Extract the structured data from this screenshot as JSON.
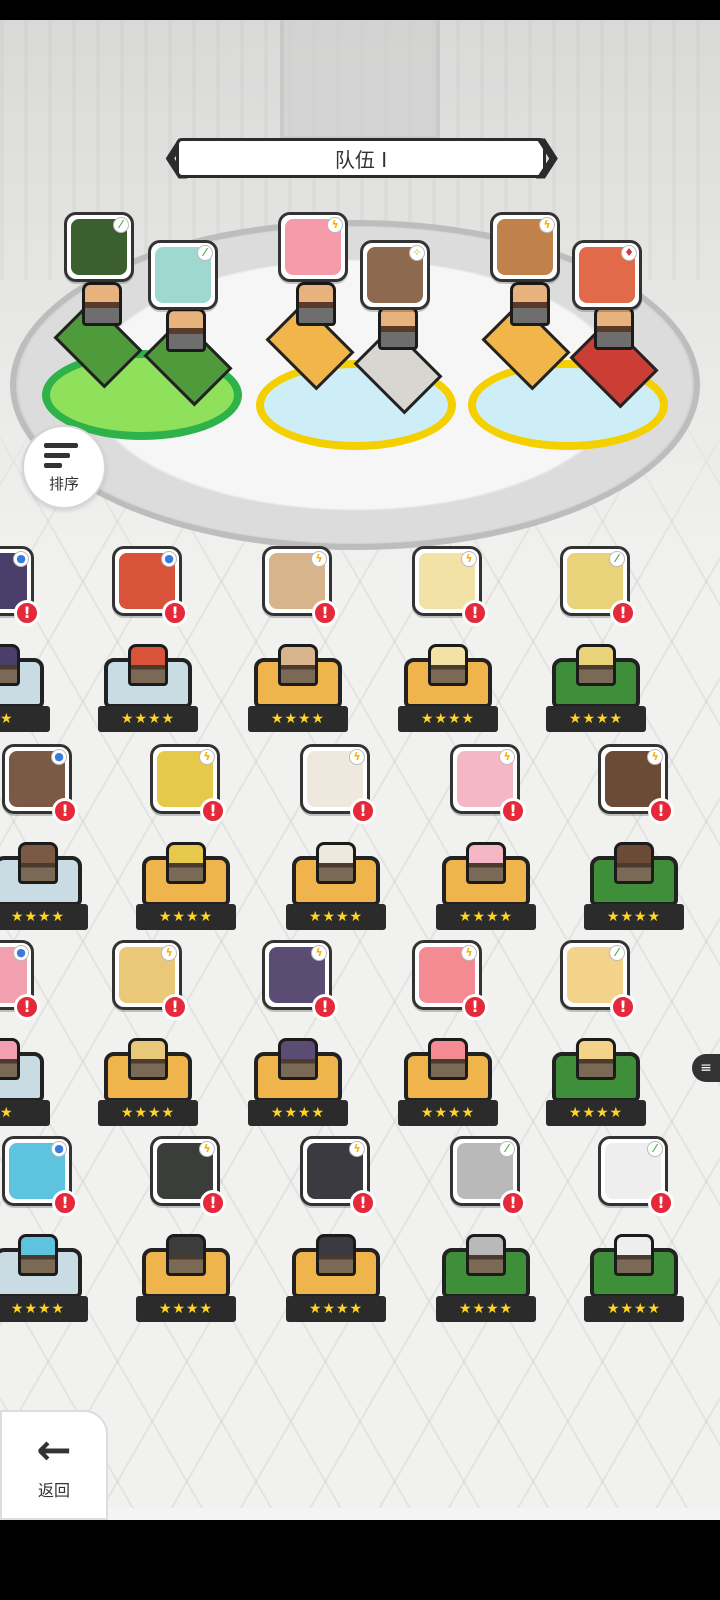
{
  "team": {
    "name": "队伍 I",
    "prev_arrow": "❮",
    "next_arrow": "❯"
  },
  "controls": {
    "sort_label": "排序",
    "back_label": "返回",
    "back_icon": "arrow-left-icon"
  },
  "colors": {
    "alert": "#e5283a",
    "star": "#ffd427",
    "ring_yellow": "#f5d000",
    "ring_green": "#2fb24a",
    "plat_green": "#4f9a3a",
    "plat_gold": "#f0b44c",
    "plat_red": "#cc3d36"
  },
  "lineup": [
    {
      "elem": "earth-icon",
      "face": "#3b5f2e"
    },
    {
      "elem": "earth-icon",
      "face": "#9fd8cf"
    },
    {
      "elem": "lightning-icon",
      "face": "#f49aa8"
    },
    {
      "elem": "light-icon",
      "face": "#8d6a4f"
    },
    {
      "elem": "lightning-icon",
      "face": "#c0824a"
    },
    {
      "elem": "fire-icon",
      "face": "#e06a4a"
    }
  ],
  "roster_rows": [
    {
      "heroes": [
        {
          "elem": "water-icon",
          "face": "#4a3f6a",
          "stars": "★★",
          "pedestal": "blue",
          "alert": "!"
        },
        {
          "elem": "water-icon",
          "face": "#d9533a",
          "stars": "★★★★",
          "pedestal": "blue",
          "alert": "!"
        },
        {
          "elem": "lightning-icon",
          "face": "#d8b48c",
          "stars": "★★★★",
          "pedestal": "gold",
          "alert": "!"
        },
        {
          "elem": "lightning-icon",
          "face": "#f2e2a6",
          "stars": "★★★★",
          "pedestal": "gold",
          "alert": "!"
        },
        {
          "elem": "earth-icon",
          "face": "#e8d27a",
          "stars": "★★★★",
          "pedestal": "green",
          "alert": "!"
        }
      ]
    },
    {
      "heroes": [
        {
          "elem": "water-icon",
          "face": "#7a5a44",
          "stars": "★★★★",
          "pedestal": "blue",
          "alert": "!"
        },
        {
          "elem": "lightning-icon",
          "face": "#e6c84a",
          "stars": "★★★★",
          "pedestal": "gold",
          "alert": "!"
        },
        {
          "elem": "lightning-icon",
          "face": "#efe8dc",
          "stars": "★★★★",
          "pedestal": "gold",
          "alert": "!"
        },
        {
          "elem": "lightning-icon",
          "face": "#f5b6c6",
          "stars": "★★★★",
          "pedestal": "gold",
          "alert": "!"
        },
        {
          "elem": "lightning-icon",
          "face": "#6b4a36",
          "stars": "★★★★",
          "pedestal": "green",
          "alert": "!"
        }
      ]
    },
    {
      "heroes": [
        {
          "elem": "water-icon",
          "face": "#f2a0b0",
          "stars": "★★",
          "pedestal": "blue",
          "alert": "!"
        },
        {
          "elem": "lightning-icon",
          "face": "#e9c979",
          "stars": "★★★★",
          "pedestal": "gold",
          "alert": "!"
        },
        {
          "elem": "lightning-icon",
          "face": "#5b4c74",
          "stars": "★★★★",
          "pedestal": "gold",
          "alert": "!"
        },
        {
          "elem": "lightning-icon",
          "face": "#f48a92",
          "stars": "★★★★",
          "pedestal": "gold",
          "alert": "!"
        },
        {
          "elem": "earth-icon",
          "face": "#f3d28a",
          "stars": "★★★★",
          "pedestal": "green",
          "alert": "!"
        }
      ]
    },
    {
      "heroes": [
        {
          "elem": "water-icon",
          "face": "#5ec3de",
          "stars": "★★★★",
          "pedestal": "blue",
          "alert": "!"
        },
        {
          "elem": "lightning-icon",
          "face": "#3a3d3a",
          "stars": "★★★★",
          "pedestal": "gold",
          "alert": "!"
        },
        {
          "elem": "lightning-icon",
          "face": "#3a3a40",
          "stars": "★★★★",
          "pedestal": "gold",
          "alert": "!"
        },
        {
          "elem": "earth-icon",
          "face": "#b9b9b9",
          "stars": "★★★★",
          "pedestal": "green",
          "alert": "!"
        },
        {
          "elem": "earth-icon",
          "face": "#eeeeee",
          "stars": "★★★★",
          "pedestal": "green",
          "alert": "!"
        }
      ]
    }
  ]
}
